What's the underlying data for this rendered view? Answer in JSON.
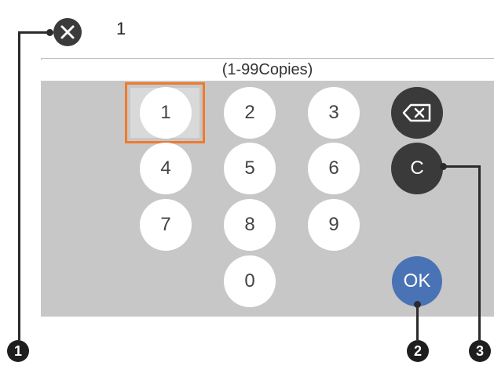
{
  "entry": {
    "value": "1"
  },
  "range_label": "(1-99Copies)",
  "keys": {
    "k1": "1",
    "k2": "2",
    "k3": "3",
    "k4": "4",
    "k5": "5",
    "k6": "6",
    "k7": "7",
    "k8": "8",
    "k9": "9",
    "k0": "0"
  },
  "clear_label": "C",
  "ok_label": "OK",
  "callouts": {
    "c1": "1",
    "c2": "2",
    "c3": "3"
  },
  "icons": {
    "close": "close-icon",
    "backspace": "backspace-icon"
  },
  "colors": {
    "focus": "#f07a2a",
    "ok": "#4a73b5",
    "dark_key": "#3a3a3a",
    "keypad_bg": "#c7c7c7"
  }
}
